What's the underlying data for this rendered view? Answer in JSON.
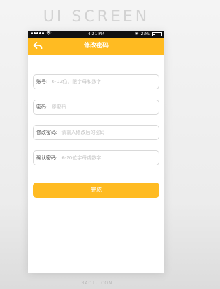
{
  "page_title": "UI SCREEN",
  "status_bar": {
    "carrier_icon": "signal-dots-icon",
    "wifi_icon": "wifi-icon",
    "time": "4:21 PM",
    "bluetooth": "✱",
    "battery": "22%"
  },
  "nav": {
    "title": "修改密码",
    "back_icon": "back-arrow-icon"
  },
  "form": {
    "fields": [
      {
        "label": "账号:",
        "value": "",
        "placeholder": "6-12位，限字母和数字"
      },
      {
        "label": "密码:",
        "value": "",
        "placeholder": "原密码"
      },
      {
        "label": "修改密码:",
        "value": "",
        "placeholder": "请输入修改后的密码"
      },
      {
        "label": "确认密码:",
        "value": "",
        "placeholder": "6-20位字母或数字"
      }
    ],
    "submit_label": "完成"
  },
  "watermark": "IBAOTU.COM",
  "colors": {
    "accent": "#ffbb22",
    "status_bar": "#111111",
    "background": "#ececec"
  }
}
